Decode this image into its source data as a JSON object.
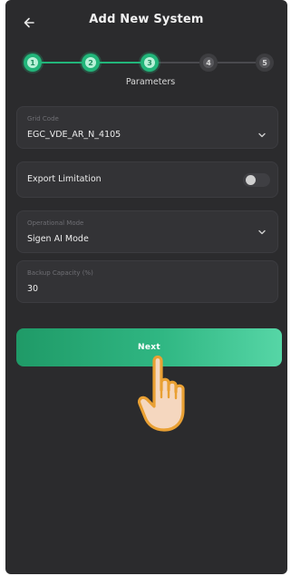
{
  "header": {
    "title": "Add New System",
    "back_icon": "arrow-left-icon"
  },
  "stepper": {
    "steps": [
      {
        "number": "1",
        "state": "done"
      },
      {
        "number": "2",
        "state": "done"
      },
      {
        "number": "3",
        "state": "done"
      },
      {
        "number": "4",
        "state": "todo"
      },
      {
        "number": "5",
        "state": "todo"
      }
    ],
    "current_label": "Parameters"
  },
  "form": {
    "grid_code": {
      "label": "Grid Code",
      "value": "EGC_VDE_AR_N_4105"
    },
    "export_limitation": {
      "label": "Export Limitation",
      "enabled": false
    },
    "operational_mode": {
      "label": "Operational Mode",
      "value": "Sigen AI Mode"
    },
    "backup_capacity": {
      "label": "Backup Capacity (%)",
      "value": "30"
    }
  },
  "actions": {
    "next_label": "Next"
  },
  "colors": {
    "accent": "#22b57a",
    "background": "#2b2b2d",
    "field": "#333336"
  }
}
